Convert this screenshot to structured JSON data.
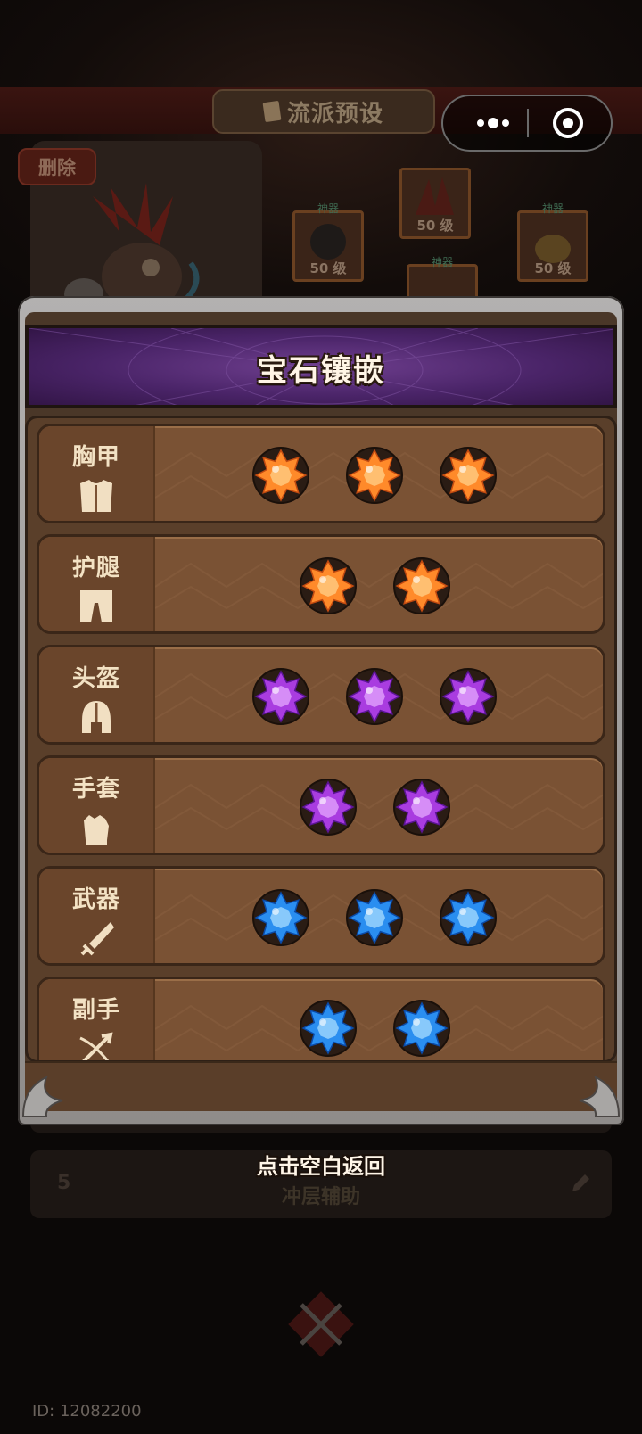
{
  "background": {
    "screen_title": "流派预设",
    "delete_label": "删除",
    "equip_tag": "神器",
    "equip_level_label": "50 级",
    "bottom_row_number": "5",
    "bottom_row_label": "冲层辅助",
    "user_id": "ID: 12082200"
  },
  "modal": {
    "title": "宝石镶嵌",
    "rows": [
      {
        "label": "胸甲",
        "icon": "chest-armor-icon",
        "gems": [
          "orange",
          "orange",
          "orange"
        ]
      },
      {
        "label": "护腿",
        "icon": "leg-armor-icon",
        "gems": [
          "orange",
          "orange"
        ]
      },
      {
        "label": "头盔",
        "icon": "helmet-icon",
        "gems": [
          "purple",
          "purple",
          "purple"
        ]
      },
      {
        "label": "手套",
        "icon": "glove-icon",
        "gems": [
          "purple",
          "purple"
        ]
      },
      {
        "label": "武器",
        "icon": "weapon-icon",
        "gems": [
          "blue",
          "blue",
          "blue"
        ]
      },
      {
        "label": "副手",
        "icon": "offhand-icon",
        "gems": [
          "blue",
          "blue"
        ]
      }
    ],
    "dismiss_hint": "点击空白返回"
  },
  "colors": {
    "gem_orange": "#ff8a2a",
    "gem_purple": "#a93ce0",
    "gem_blue": "#2a8ef0",
    "banner_purple": "#4a2468"
  }
}
